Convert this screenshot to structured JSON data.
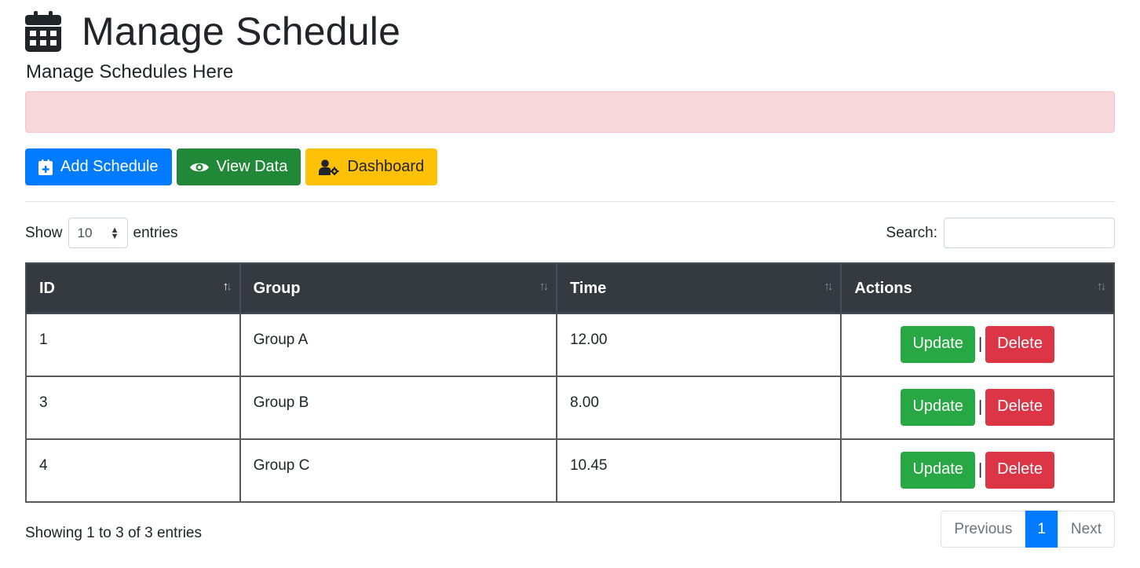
{
  "header": {
    "title": "Manage Schedule",
    "subtitle": "Manage Schedules Here"
  },
  "toolbar": {
    "add_label": "Add Schedule",
    "view_label": "View Data",
    "dashboard_label": "Dashboard"
  },
  "controls": {
    "show_label": "Show",
    "length_value": "10",
    "entries_label": "entries",
    "search_label": "Search:",
    "search_value": ""
  },
  "table": {
    "columns": [
      "ID",
      "Group",
      "Time",
      "Actions"
    ],
    "rows": [
      {
        "id": "1",
        "group": "Group A",
        "time": "12.00"
      },
      {
        "id": "3",
        "group": "Group B",
        "time": "8.00"
      },
      {
        "id": "4",
        "group": "Group C",
        "time": "10.45"
      }
    ],
    "update_label": "Update",
    "delete_label": "Delete",
    "separator": "|"
  },
  "footer": {
    "info": "Showing 1 to 3 of 3 entries",
    "prev_label": "Previous",
    "page": "1",
    "next_label": "Next"
  },
  "colors": {
    "primary": "#007bff",
    "success": "#28a745",
    "warning": "#ffc107",
    "danger": "#dc3545",
    "alert_bg": "#f8d7da",
    "table_header": "#343a40"
  },
  "icons": {
    "title": "calendar-icon",
    "add": "calendar-plus-icon",
    "view": "eye-icon",
    "dashboard": "user-cog-icon"
  }
}
